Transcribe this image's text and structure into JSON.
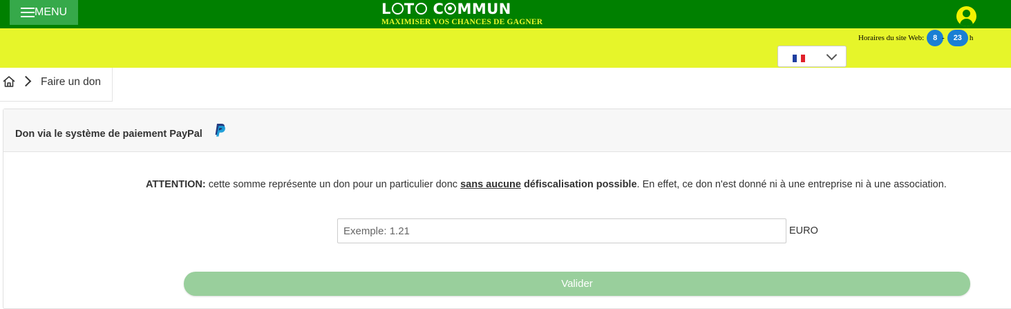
{
  "header": {
    "menu_label": "MENU",
    "brand_title_parts": [
      "L",
      "T",
      " C",
      "MMUN"
    ],
    "brand_subtitle": "MAXIMISER VOS CHANCES DE GAGNER",
    "icons": {
      "menu": "hamburger-icon",
      "user": "user-account-icon"
    }
  },
  "subheader": {
    "hours_label": "Horaires du site Web:",
    "hours_start": "8",
    "hours_separator": "-",
    "hours_end": "23",
    "hours_unit": "h",
    "language_selected_flag": "french-flag-icon"
  },
  "breadcrumb": {
    "home_icon": "home-icon",
    "current": "Faire un don"
  },
  "donation": {
    "title": "Don via le système de paiement PayPal",
    "warning_label": "ATTENTION:",
    "warning_text_1": " cette somme représente un don pour un particulier donc ",
    "warning_emphasis_underlined": "sans aucune",
    "warning_emphasis_bold": " défiscalisation possible",
    "warning_text_2": ". En effet, ce don n'est donné ni à une entreprise ni à une association.",
    "amount_placeholder": "Exemple: 1.21",
    "amount_value": "",
    "currency": "EURO",
    "submit_label": "Valider"
  },
  "colors": {
    "header_green": "#008000",
    "menu_button": "#36a94a",
    "yellow_bar": "#e6f52a",
    "badge_blue": "#1a7fd4",
    "submit_button": "#99cf9c"
  }
}
